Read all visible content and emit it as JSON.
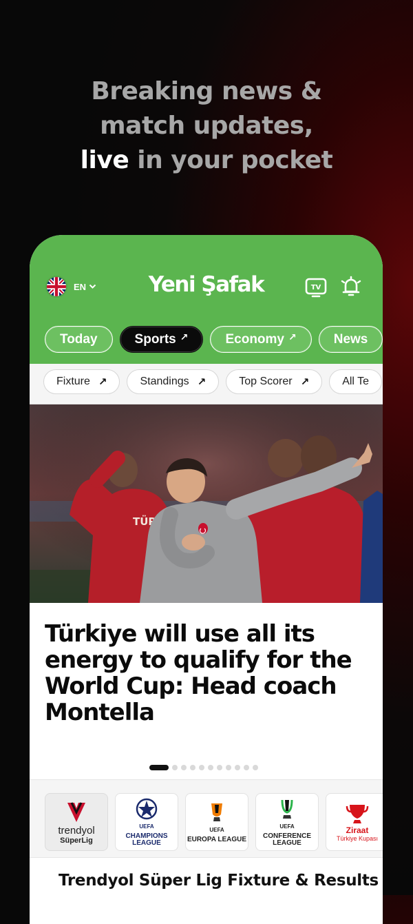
{
  "promo": {
    "line1": "Breaking news &",
    "line2": "match updates,",
    "line3_highlight": "live",
    "line3_rest": " in your pocket"
  },
  "header": {
    "language": "EN",
    "logo_text": "Yeni Şafak",
    "tv_icon_label": "TV"
  },
  "tabs": [
    {
      "label": "Today",
      "arrow": ""
    },
    {
      "label": "Sports",
      "arrow": "↗"
    },
    {
      "label": "Economy",
      "arrow": "↗"
    },
    {
      "label": "News",
      "arrow": ""
    }
  ],
  "subnav": [
    {
      "label": "Fixture",
      "arrow": "↗"
    },
    {
      "label": "Standings",
      "arrow": "↗"
    },
    {
      "label": "Top Scorer",
      "arrow": "↗"
    },
    {
      "label": "All Te",
      "arrow": ""
    }
  ],
  "hero": {
    "jersey_text": "TÜRKİYE"
  },
  "article": {
    "title": "Türkiye will use all its energy to qualify for the World Cup: Head coach Montella"
  },
  "carousel": {
    "count": 11,
    "active_index": 0
  },
  "leagues": [
    {
      "name_top": "trendyol",
      "name_bottom": "SüperLig",
      "icon": "super-lig-logo",
      "active": true
    },
    {
      "name_top": "UEFA",
      "name_bottom": "CHAMPIONS LEAGUE",
      "icon": "champions-league-logo",
      "active": false
    },
    {
      "name_top": "UEFA",
      "name_bottom": "EUROPA LEAGUE",
      "icon": "europa-league-logo",
      "active": false
    },
    {
      "name_top": "UEFA",
      "name_bottom": "CONFERENCE LEAGUE",
      "icon": "conference-league-logo",
      "active": false
    },
    {
      "name_top": "Ziraat",
      "name_bottom": "Türkiye Kupası",
      "icon": "turkiye-kupasi-logo",
      "active": false
    }
  ],
  "section": {
    "title": "Trendyol Süper Lig Fixture & Results"
  },
  "colors": {
    "brand_green": "#5bb54f",
    "active_tab": "#0b0b0b",
    "promo_grey": "#a7a7a7"
  }
}
